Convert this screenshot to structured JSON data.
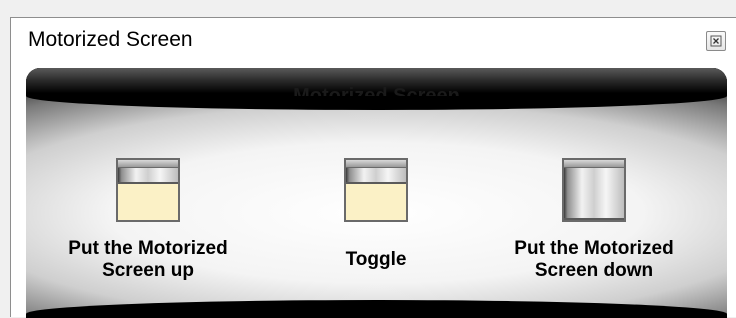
{
  "window": {
    "title": "Motorized Screen",
    "close_icon": "close-icon"
  },
  "panel": {
    "title": "Motorized Screen"
  },
  "actions": [
    {
      "label": "Put the Motorized Screen up",
      "icon": "screen-up-icon",
      "screen_lowered": 0.3
    },
    {
      "label": "Toggle",
      "icon": "screen-toggle-icon",
      "screen_lowered": 0.3
    },
    {
      "label": "Put the Motorized Screen down",
      "icon": "screen-down-icon",
      "screen_lowered": 1.0
    }
  ],
  "colors": {
    "wall": "#fbf1c6",
    "panel_frame": "#000000"
  }
}
